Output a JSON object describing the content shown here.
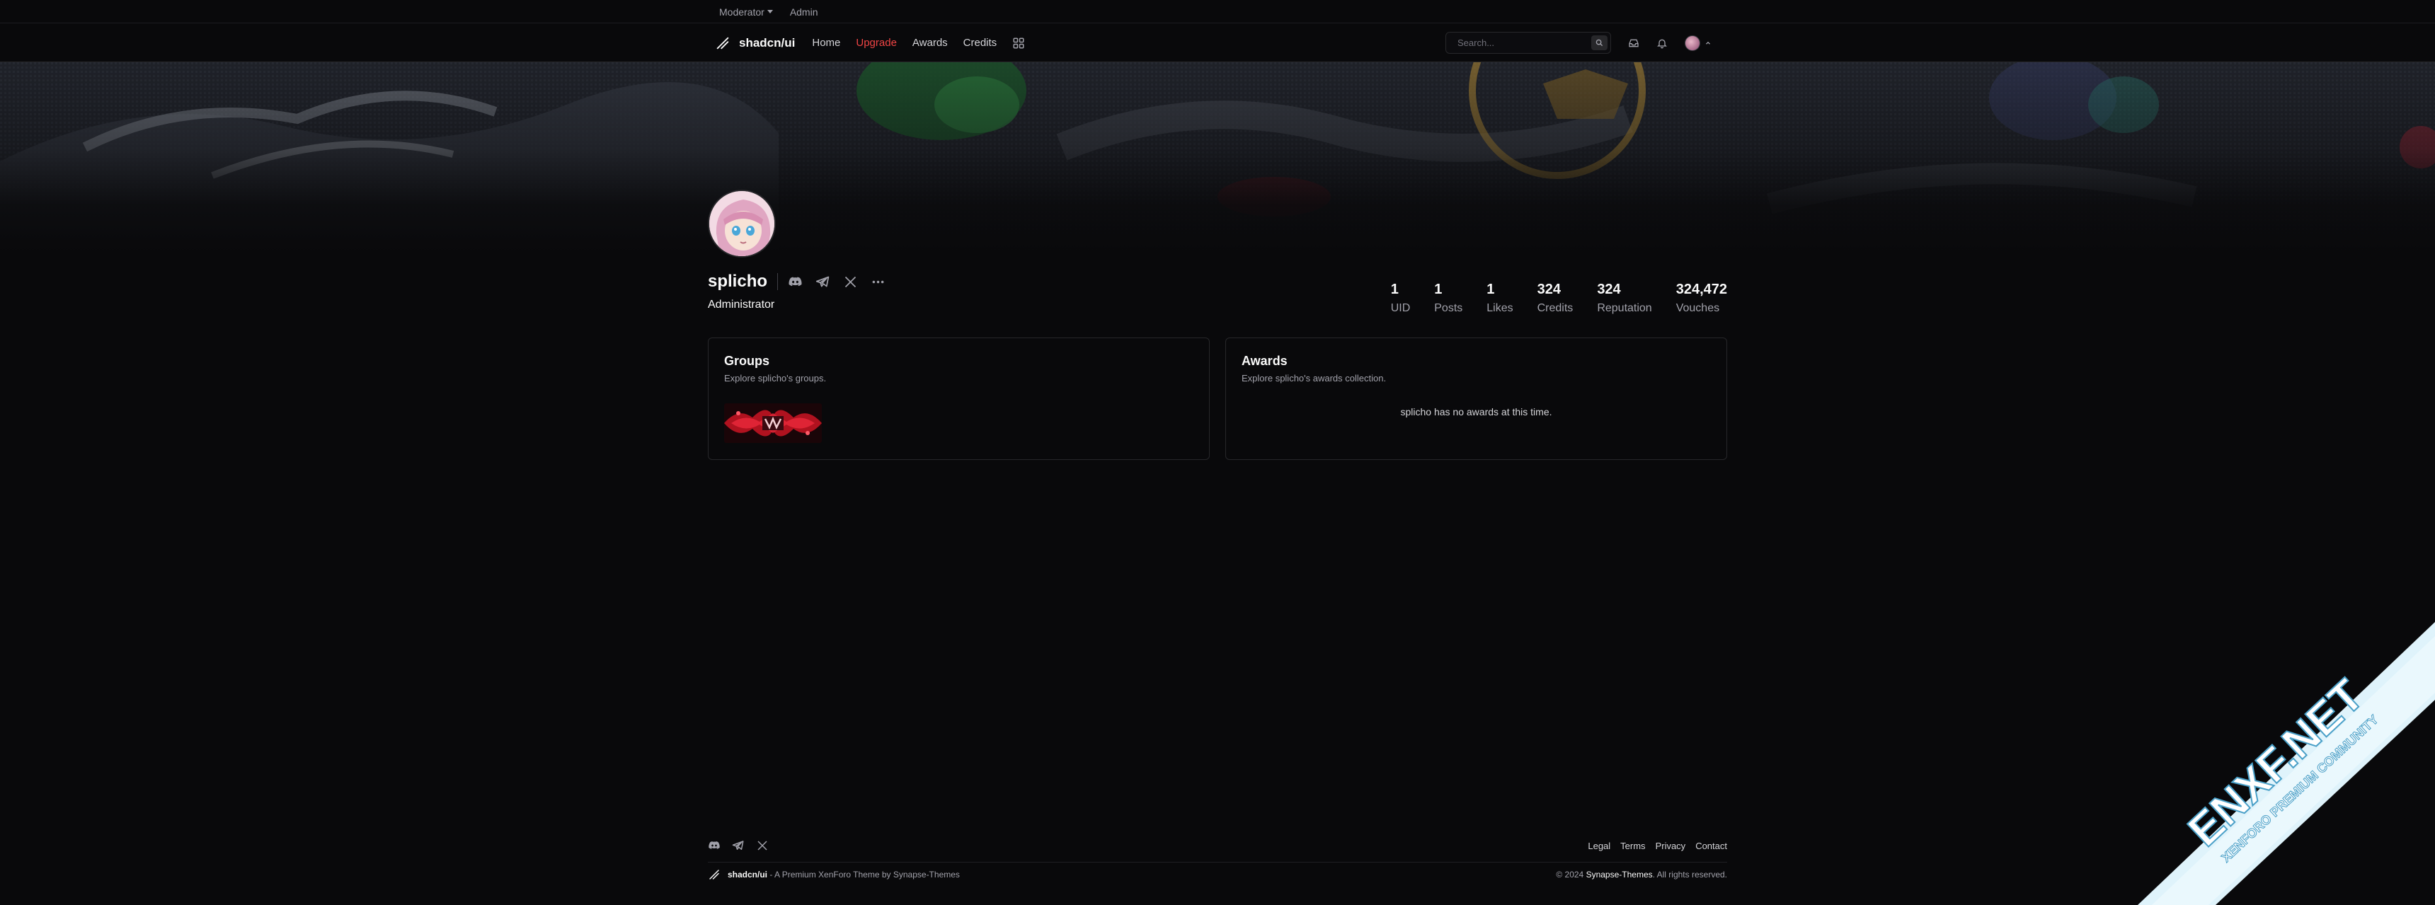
{
  "adminbar": {
    "moderator": "Moderator",
    "admin": "Admin"
  },
  "nav": {
    "brand": "shadcn/ui",
    "links": [
      "Home",
      "Upgrade",
      "Awards",
      "Credits"
    ],
    "search_placeholder": "Search...",
    "accent_color": "#ef4444"
  },
  "profile": {
    "username": "splicho",
    "role": "Administrator",
    "socials": [
      "discord-icon",
      "telegram-icon",
      "x-icon",
      "more-icon"
    ],
    "stats": [
      {
        "value": "1",
        "label": "UID"
      },
      {
        "value": "1",
        "label": "Posts"
      },
      {
        "value": "1",
        "label": "Likes"
      },
      {
        "value": "324",
        "label": "Credits"
      },
      {
        "value": "324",
        "label": "Reputation"
      },
      {
        "value": "324,472",
        "label": "Vouches"
      }
    ]
  },
  "groups": {
    "title": "Groups",
    "subtitle": "Explore splicho's groups."
  },
  "awards": {
    "title": "Awards",
    "subtitle": "Explore splicho's awards collection.",
    "empty": "splicho has no awards at this time."
  },
  "footer": {
    "links": [
      "Legal",
      "Terms",
      "Privacy",
      "Contact"
    ],
    "brand": "shadcn/ui",
    "tagline": " - A Premium XenForo Theme by Synapse-Themes",
    "copyright_prefix": "© 2024 ",
    "copyright_owner": "Synapse-Themes",
    "copyright_suffix": ". All rights reserved."
  },
  "watermark": {
    "line1": "ENXF.NET",
    "line2": "XENFORO PREMIUM COMMUNITY"
  }
}
